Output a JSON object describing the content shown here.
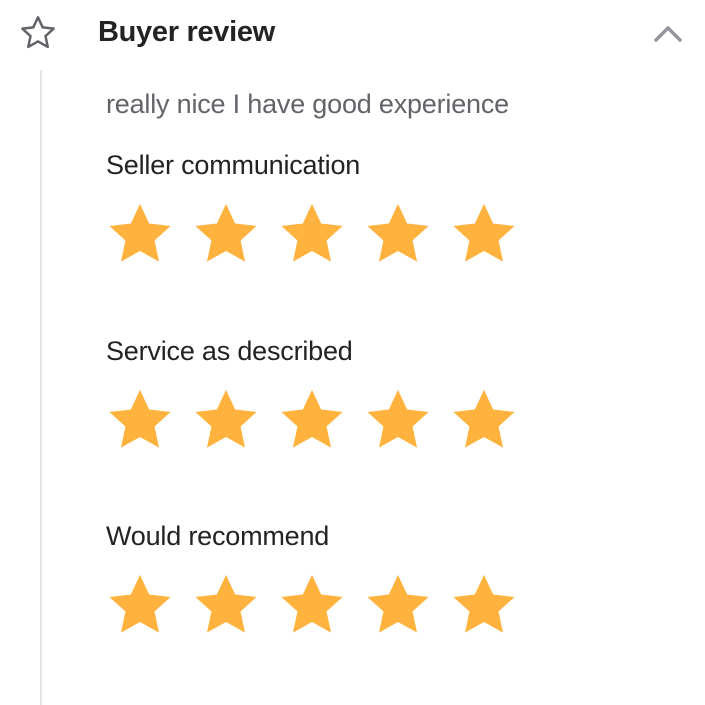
{
  "header": {
    "title": "Buyer review",
    "icon": "star-outline-icon",
    "toggle_icon": "chevron-up-icon"
  },
  "review": {
    "comment": "really nice I have good experience"
  },
  "ratings": [
    {
      "label": "Seller communication",
      "stars": 5,
      "max": 5
    },
    {
      "label": "Service as described",
      "stars": 5,
      "max": 5
    },
    {
      "label": "Would recommend",
      "stars": 5,
      "max": 5
    }
  ],
  "colors": {
    "star": "#FFB33E",
    "text": "#222325",
    "muted_text": "#62646A",
    "rail": "#E4E5E7"
  }
}
